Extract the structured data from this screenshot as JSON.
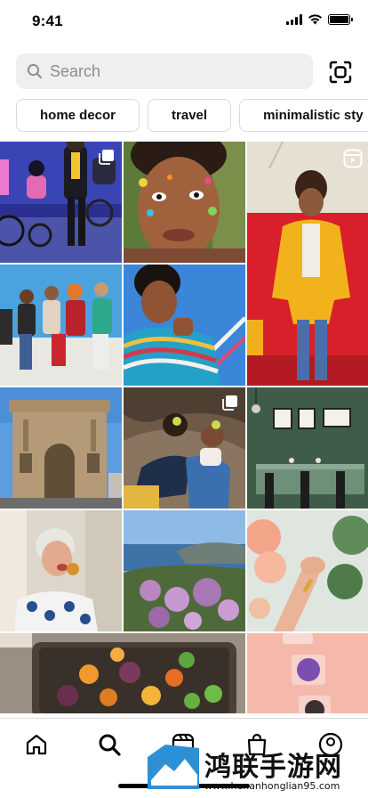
{
  "status_bar": {
    "time": "9:41",
    "icons": [
      "cellular-signal-icon",
      "wifi-icon",
      "battery-icon"
    ]
  },
  "search": {
    "placeholder": "Search",
    "value": "",
    "icon": "search-icon",
    "scan_icon": "qr-scan-icon"
  },
  "chips": [
    {
      "label": "home decor"
    },
    {
      "label": "travel"
    },
    {
      "label": "minimalistic sty"
    }
  ],
  "grid": {
    "tiles": [
      {
        "subject": "kids-cycling-night",
        "badge": "carousel-icon"
      },
      {
        "subject": "face-paint-portrait",
        "badge": ""
      },
      {
        "subject": "man-yellow-jacket-red-room",
        "badge": "reels-icon"
      },
      {
        "subject": "group-on-wall",
        "badge": ""
      },
      {
        "subject": "man-striped-sweater",
        "badge": ""
      },
      {
        "subject": "triumphal-arch",
        "badge": ""
      },
      {
        "subject": "couple-lying-on-rocks",
        "badge": "carousel-icon"
      },
      {
        "subject": "green-dining-room",
        "badge": ""
      },
      {
        "subject": "woman-eating",
        "badge": ""
      },
      {
        "subject": "coastal-flowers",
        "badge": ""
      },
      {
        "subject": "hand-with-roses",
        "badge": ""
      },
      {
        "subject": "roasted-vegetables",
        "badge": ""
      },
      {
        "subject": "eyeshadow-pots",
        "badge": ""
      }
    ]
  },
  "tab_bar": {
    "tabs": [
      {
        "icon": "home-icon",
        "active": false
      },
      {
        "icon": "search-icon",
        "active": true
      },
      {
        "icon": "reels-icon",
        "active": false
      },
      {
        "icon": "shop-bag-icon",
        "active": false
      },
      {
        "icon": "profile-icon",
        "active": false
      }
    ]
  },
  "watermark": {
    "title": "鸿联手游网",
    "url": "www.henanhonglian95.com"
  },
  "colors": {
    "search_bg": "#efefef",
    "chip_border": "#dbdbdb",
    "placeholder": "#8e8e8e"
  }
}
